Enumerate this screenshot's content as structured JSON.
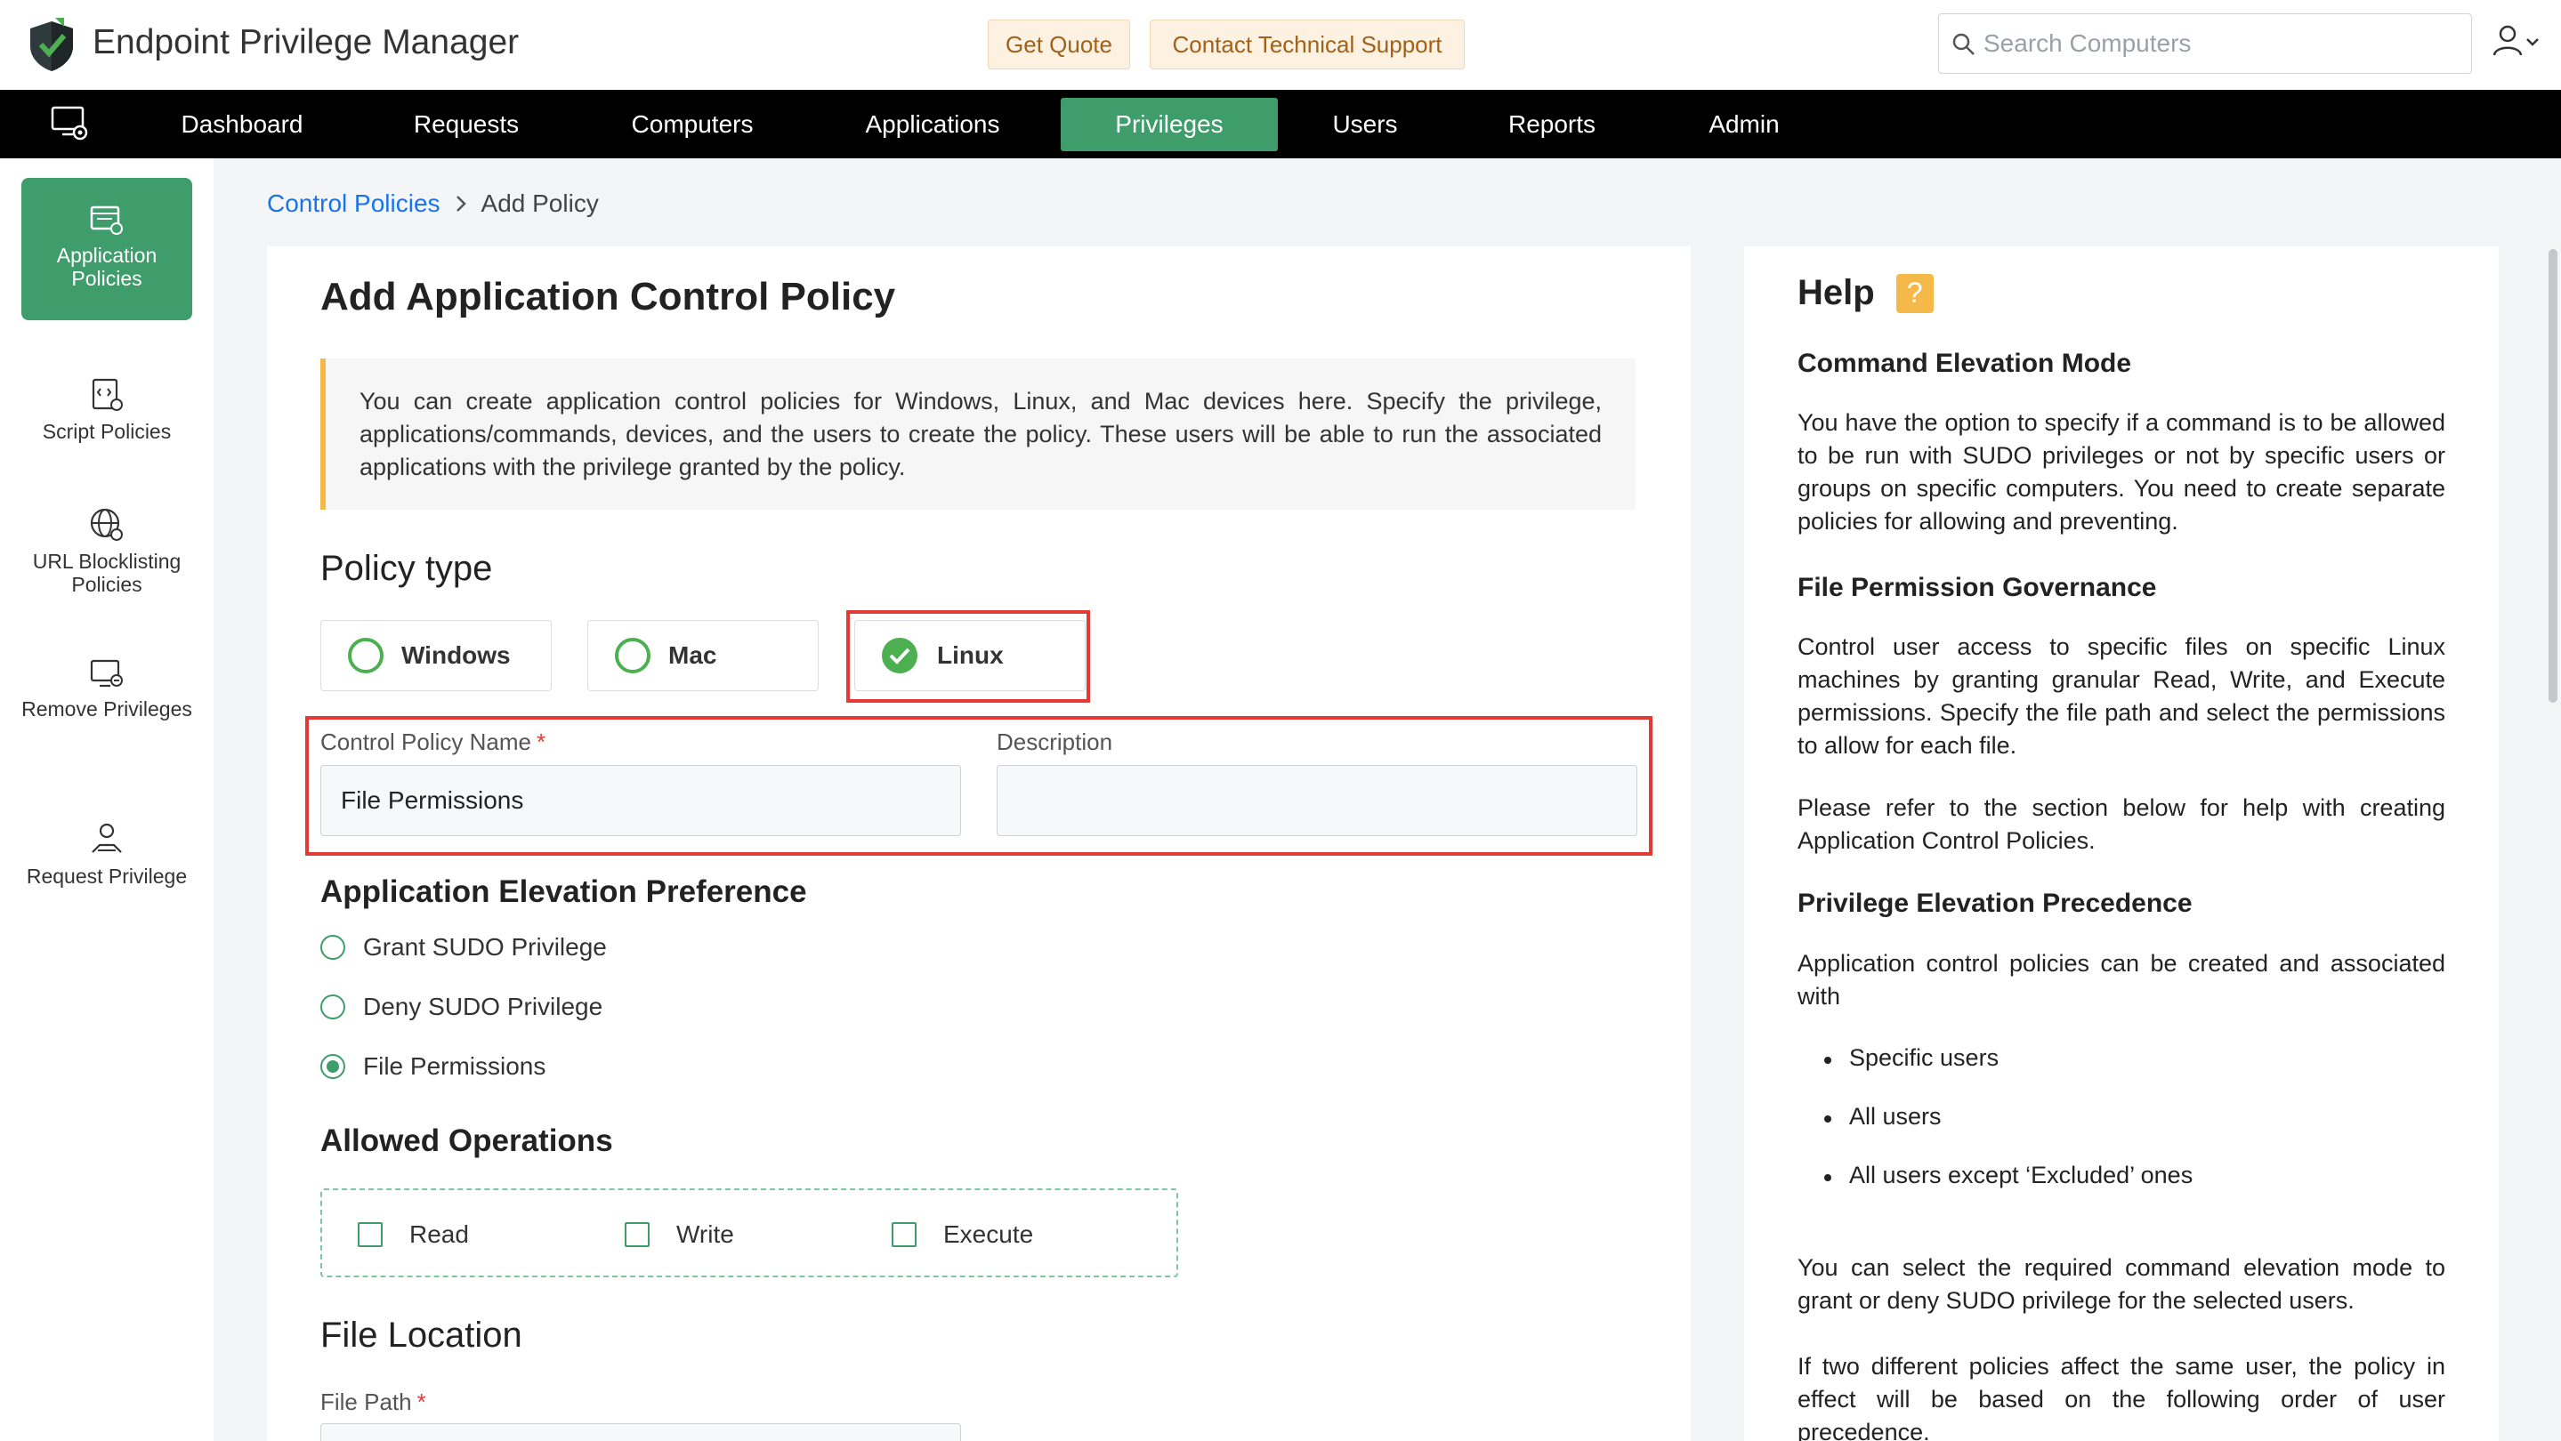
{
  "app": {
    "title": "Endpoint Privilege Manager",
    "get_quote": "Get Quote",
    "contact_support": "Contact Technical Support",
    "search_placeholder": "Search Computers"
  },
  "nav": {
    "items": [
      "Dashboard",
      "Requests",
      "Computers",
      "Applications",
      "Privileges",
      "Users",
      "Reports",
      "Admin"
    ],
    "active": "Privileges"
  },
  "sidebar": {
    "items": [
      {
        "label": "Application Policies",
        "icon": "application-policies-icon",
        "active": true
      },
      {
        "label": "Script Policies",
        "icon": "script-policies-icon"
      },
      {
        "label": "URL Blocklisting Policies",
        "icon": "globe-icon"
      },
      {
        "label": "Remove Privileges",
        "icon": "remove-privileges-icon"
      },
      {
        "label": "Request Privilege",
        "icon": "request-privilege-icon"
      }
    ]
  },
  "breadcrumb": {
    "parent": "Control Policies",
    "current": "Add Policy"
  },
  "form": {
    "heading": "Add Application Control Policy",
    "info": "You can create application control policies for Windows, Linux, and Mac devices here. Specify the privilege, applications/commands, devices, and the users to create the policy. These users will be able to run the associated applications with the privilege granted by the policy.",
    "policy_type_title": "Policy type",
    "policy_types": [
      "Windows",
      "Mac",
      "Linux"
    ],
    "policy_type_selected": "Linux",
    "name_label": "Control Policy Name",
    "name_value": "File Permissions",
    "description_label": "Description",
    "description_value": "",
    "elevation_title": "Application Elevation Preference",
    "elevation_options": [
      "Grant SUDO Privilege",
      "Deny SUDO Privilege",
      "File Permissions"
    ],
    "elevation_selected": "File Permissions",
    "ops_title": "Allowed Operations",
    "ops": [
      "Read",
      "Write",
      "Execute"
    ],
    "file_location_title": "File Location",
    "file_path_label": "File Path",
    "required_mark": "*"
  },
  "help": {
    "title": "Help",
    "q_mark": "?",
    "h1": "Command Elevation Mode",
    "p1": "You have the option to specify if a command is to be allowed to be run with SUDO privileges or not by specific users or groups on specific computers. You need to create separate policies for allowing and preventing.",
    "h2": "File Permission Governance",
    "p2": "Control user access to specific files on specific Linux machines by granting granular Read, Write, and Execute permissions. Specify the file path and select the permissions to allow for each file.",
    "p3": "Please refer to the section below for help with creating Application Control Policies.",
    "h3": "Privilege Elevation Precedence",
    "p4": "Application control policies can be created and associated with",
    "list": [
      "Specific users",
      "All users",
      "All users except ‘Excluded’ ones"
    ],
    "p5": "You can select the required command elevation mode to grant or deny SUDO privilege for the selected users.",
    "p6": "If two different policies affect the same user, the policy in effect will be based on the following order of user precedence."
  },
  "colors": {
    "accent": "#3f9c6b",
    "highlight": "#e53935",
    "warning": "#f5b94a"
  }
}
